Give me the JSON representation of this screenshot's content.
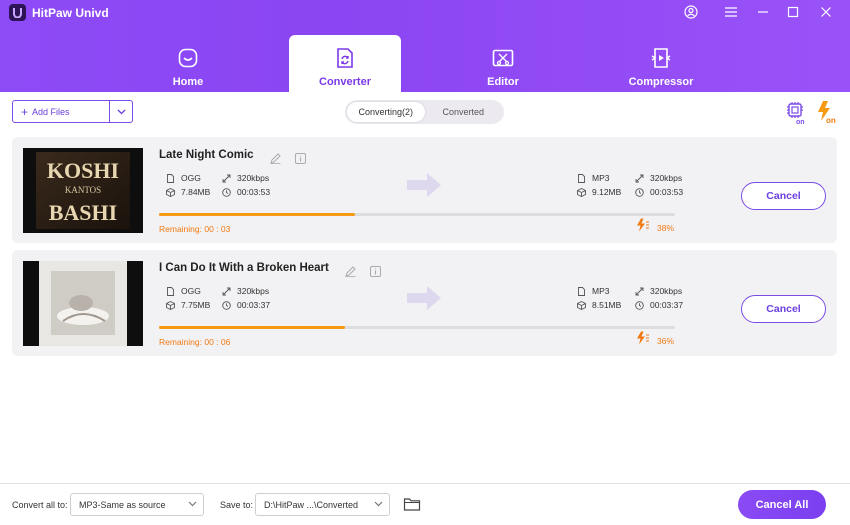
{
  "app": {
    "title": "HitPaw Univd"
  },
  "nav": {
    "tabs": [
      {
        "label": "Home",
        "icon": "home-icon"
      },
      {
        "label": "Converter",
        "icon": "converter-icon",
        "active": true
      },
      {
        "label": "Editor",
        "icon": "editor-icon"
      },
      {
        "label": "Compressor",
        "icon": "compressor-icon"
      }
    ]
  },
  "toolbar": {
    "add_files_label": "Add Files",
    "segment": {
      "converting": "Converting(2)",
      "converted": "Converted"
    }
  },
  "items": [
    {
      "title": "Late Night Comic",
      "src_format": "OGG",
      "src_bitrate": "320kbps",
      "src_size": "7.84MB",
      "src_duration": "00:03:53",
      "dst_format": "MP3",
      "dst_bitrate": "320kbps",
      "dst_size": "9.12MB",
      "dst_duration": "00:03:53",
      "remaining": "Remaining: 00 : 03",
      "percent_label": "38%",
      "progress": 0.38,
      "cancel_label": "Cancel"
    },
    {
      "title": "I Can Do It With a Broken Heart",
      "src_format": "OGG",
      "src_bitrate": "320kbps",
      "src_size": "7.75MB",
      "src_duration": "00:03:37",
      "dst_format": "MP3",
      "dst_bitrate": "320kbps",
      "dst_size": "8.51MB",
      "dst_duration": "00:03:37",
      "remaining": "Remaining: 00 : 06",
      "percent_label": "36%",
      "progress": 0.36,
      "cancel_label": "Cancel"
    }
  ],
  "footer": {
    "convert_all_label": "Convert all to:",
    "convert_all_value": "MP3-Same as source",
    "save_to_label": "Save to:",
    "save_to_value": "D:\\HitPaw ...\\Converted",
    "cancel_all_label": "Cancel All"
  },
  "album_art": {
    "item1_lines": [
      "KOSHI",
      "KANTOS",
      "BASHI"
    ]
  },
  "colors": {
    "accent": "#7b4de6",
    "orange": "#f59a12"
  }
}
